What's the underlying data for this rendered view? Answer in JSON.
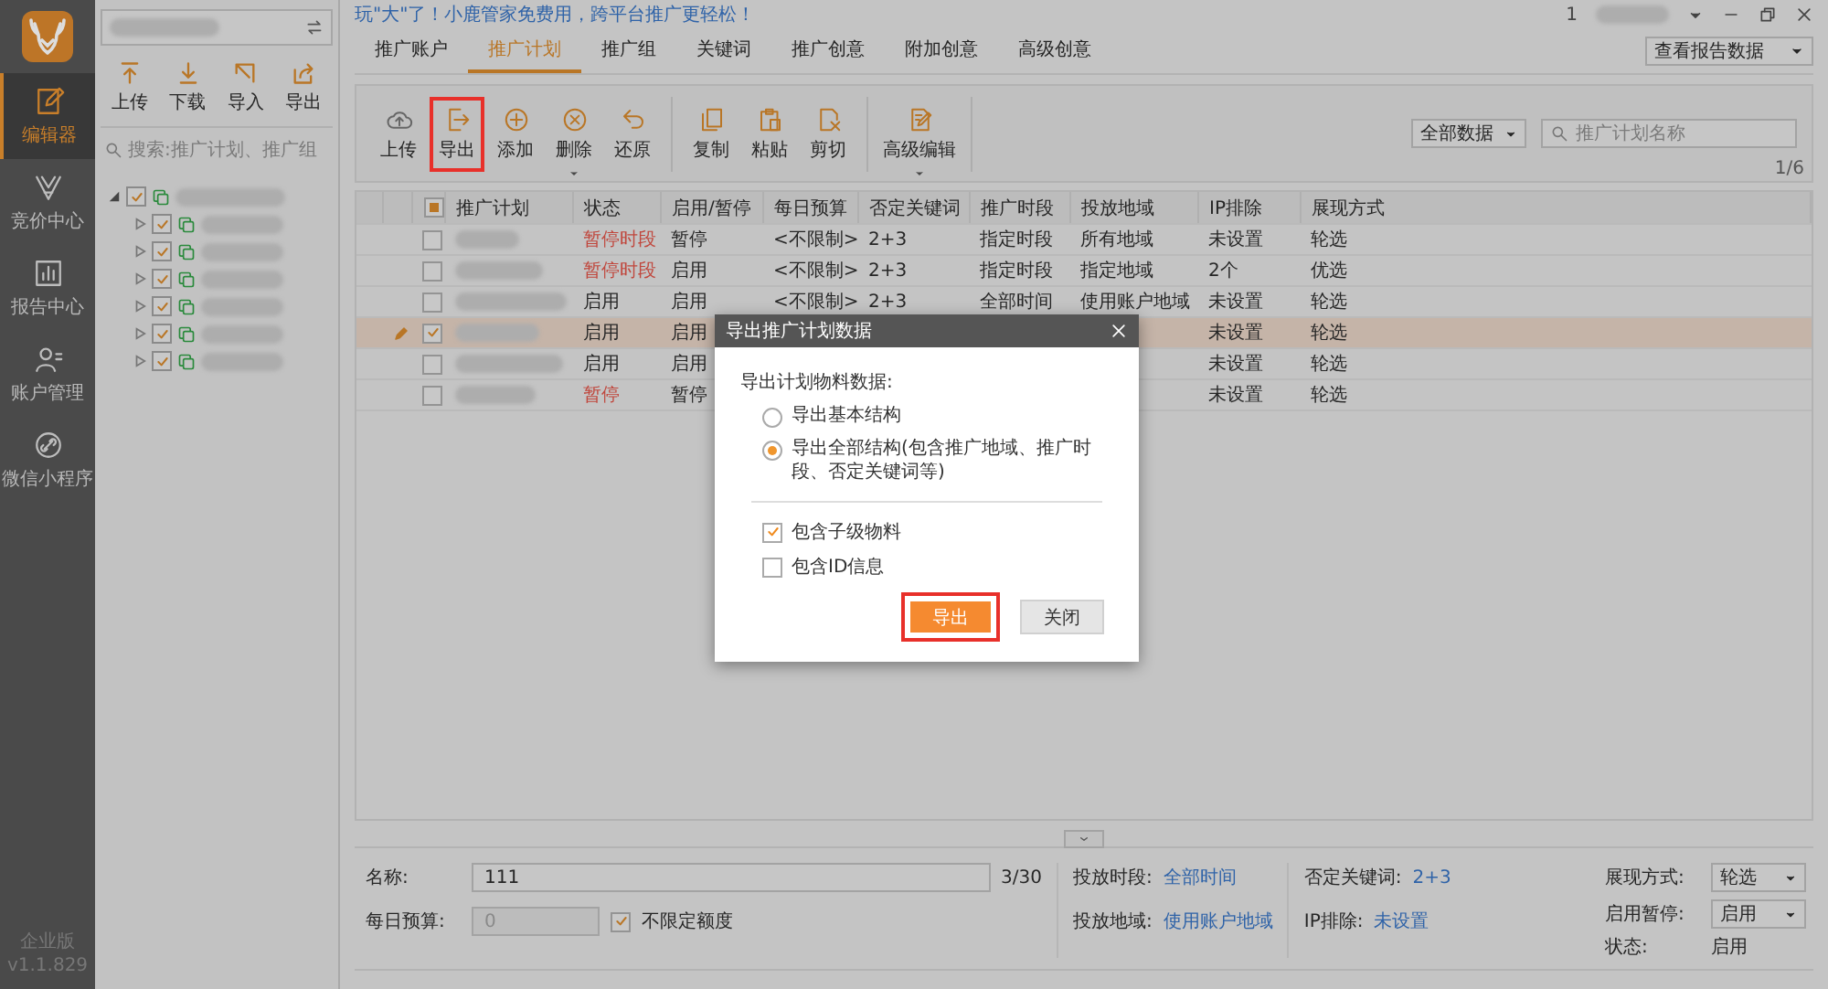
{
  "nav": {
    "items": [
      {
        "label": "编辑器",
        "kind": "edit",
        "selected": true
      },
      {
        "label": "竞价中心",
        "kind": "bid",
        "selected": false
      },
      {
        "label": "报告中心",
        "kind": "report",
        "selected": false
      },
      {
        "label": "账户管理",
        "kind": "user",
        "selected": false
      },
      {
        "label": "微信小程序",
        "kind": "link",
        "selected": false
      }
    ],
    "edition": "企业版",
    "version": "v1.1.829"
  },
  "account_panel": {
    "toolbar": [
      {
        "label": "上传",
        "kind": "upload"
      },
      {
        "label": "下载",
        "kind": "download"
      },
      {
        "label": "导入",
        "kind": "import"
      },
      {
        "label": "导出",
        "kind": "share"
      }
    ],
    "search": {
      "placeholder": "搜索:推广计划、推广组"
    },
    "tree": [
      {
        "expanded": true,
        "checked": true,
        "children": [
          {
            "expanded": false,
            "checked": true
          },
          {
            "expanded": false,
            "checked": true
          },
          {
            "expanded": false,
            "checked": true
          },
          {
            "expanded": false,
            "checked": true
          },
          {
            "expanded": false,
            "checked": true
          },
          {
            "expanded": false,
            "checked": true
          }
        ]
      }
    ]
  },
  "top_bar": {
    "notice": "玩\"大\"了！小鹿管家免费用，跨平台推广更轻松！",
    "user": "1"
  },
  "tabs": [
    {
      "label": "推广账户",
      "selected": false
    },
    {
      "label": "推广计划",
      "selected": true
    },
    {
      "label": "推广组",
      "selected": false
    },
    {
      "label": "关键词",
      "selected": false
    },
    {
      "label": "推广创意",
      "selected": false
    },
    {
      "label": "附加创意",
      "selected": false
    },
    {
      "label": "高级创意",
      "selected": false
    }
  ],
  "report_select": {
    "value": "查看报告数据"
  },
  "toolbar": {
    "groups": [
      [
        {
          "label": "上传",
          "kind": "cloud",
          "highlighted": false,
          "dropdown": false
        },
        {
          "label": "导出",
          "kind": "export",
          "highlighted": true,
          "dropdown": false
        },
        {
          "label": "添加",
          "kind": "add",
          "highlighted": false,
          "dropdown": false
        },
        {
          "label": "删除",
          "kind": "delete",
          "highlighted": false,
          "dropdown": true
        },
        {
          "label": "还原",
          "kind": "undo",
          "highlighted": false,
          "dropdown": false
        }
      ],
      [
        {
          "label": "复制",
          "kind": "copy",
          "highlighted": false,
          "dropdown": false
        },
        {
          "label": "粘贴",
          "kind": "paste",
          "highlighted": false,
          "dropdown": false
        },
        {
          "label": "剪切",
          "kind": "cut",
          "highlighted": false,
          "dropdown": false
        }
      ],
      [
        {
          "label": "高级编辑",
          "kind": "advanced",
          "highlighted": false,
          "dropdown": true
        }
      ]
    ],
    "filter": {
      "value": "全部数据"
    },
    "search": {
      "placeholder": "推广计划名称"
    },
    "page": "1/6"
  },
  "table": {
    "select_all": true,
    "columns": [
      "推广计划",
      "状态",
      "启用/暂停",
      "每日预算",
      "否定关键词",
      "推广时段",
      "投放地域",
      "IP排除",
      "展现方式"
    ],
    "rows": [
      {
        "selected": false,
        "checked": false,
        "status": "暂停时段",
        "color": "#c0473d",
        "enabled": "暂停",
        "budget": "<不限制>",
        "negative_keywords": "2+3",
        "schedule": "指定时段",
        "region": "所有地域",
        "ip_exclusion": "未设置",
        "display_mode": "轮选"
      },
      {
        "selected": false,
        "checked": false,
        "status": "暂停时段",
        "color": "#c0473d",
        "enabled": "启用",
        "budget": "<不限制>",
        "negative_keywords": "2+3",
        "schedule": "指定时段",
        "region": "指定地域",
        "ip_exclusion": "2个",
        "display_mode": "优选"
      },
      {
        "selected": false,
        "checked": false,
        "status": "启用",
        "color": "#262626",
        "enabled": "启用",
        "budget": "<不限制>",
        "negative_keywords": "2+3",
        "schedule": "全部时间",
        "region": "使用账户地域",
        "ip_exclusion": "未设置",
        "display_mode": "轮选"
      },
      {
        "selected": true,
        "checked": true,
        "status": "启用",
        "color": "#262626",
        "enabled": "启用",
        "ip_exclusion": "未设置",
        "display_mode": "轮选"
      },
      {
        "selected": false,
        "checked": false,
        "status": "启用",
        "color": "#262626",
        "enabled": "启用",
        "ip_exclusion": "未设置",
        "display_mode": "轮选"
      },
      {
        "selected": false,
        "checked": false,
        "status": "暂停",
        "color": "#c0473d",
        "enabled": "暂停",
        "ip_exclusion": "未设置",
        "display_mode": "轮选"
      }
    ]
  },
  "details": {
    "name": {
      "label": "名称:",
      "value": "111",
      "count": "3/30"
    },
    "budget": {
      "label": "每日预算:",
      "value": "0",
      "disabled": true,
      "unlimited": {
        "label": "不限定额度",
        "checked": true
      }
    },
    "schedule": {
      "label": "投放时段:",
      "value": "全部时间"
    },
    "region": {
      "label": "投放地域:",
      "value": "使用账户地域"
    },
    "negative": {
      "label": "否定关键词:",
      "value": "2+3"
    },
    "ip": {
      "label": "IP排除:",
      "value": "未设置"
    },
    "display": {
      "label": "展现方式:",
      "value": "轮选"
    },
    "enable": {
      "label": "启用暂停:",
      "value": "启用"
    },
    "state": {
      "label": "状态:",
      "value": "启用"
    }
  },
  "dialog": {
    "title": "导出推广计划数据",
    "section": "导出计划物料数据:",
    "options": [
      {
        "label": "导出基本结构",
        "selected": false
      },
      {
        "label": "导出全部结构(包含推广地域、推广时段、否定关键词等)",
        "selected": true
      }
    ],
    "checks": [
      {
        "label": "包含子级物料",
        "checked": true
      },
      {
        "label": "包含ID信息",
        "checked": false
      }
    ],
    "buttons": [
      {
        "label": "导出",
        "kind": "primary",
        "highlighted": true
      },
      {
        "label": "关闭",
        "kind": "secondary",
        "highlighted": false
      }
    ]
  }
}
